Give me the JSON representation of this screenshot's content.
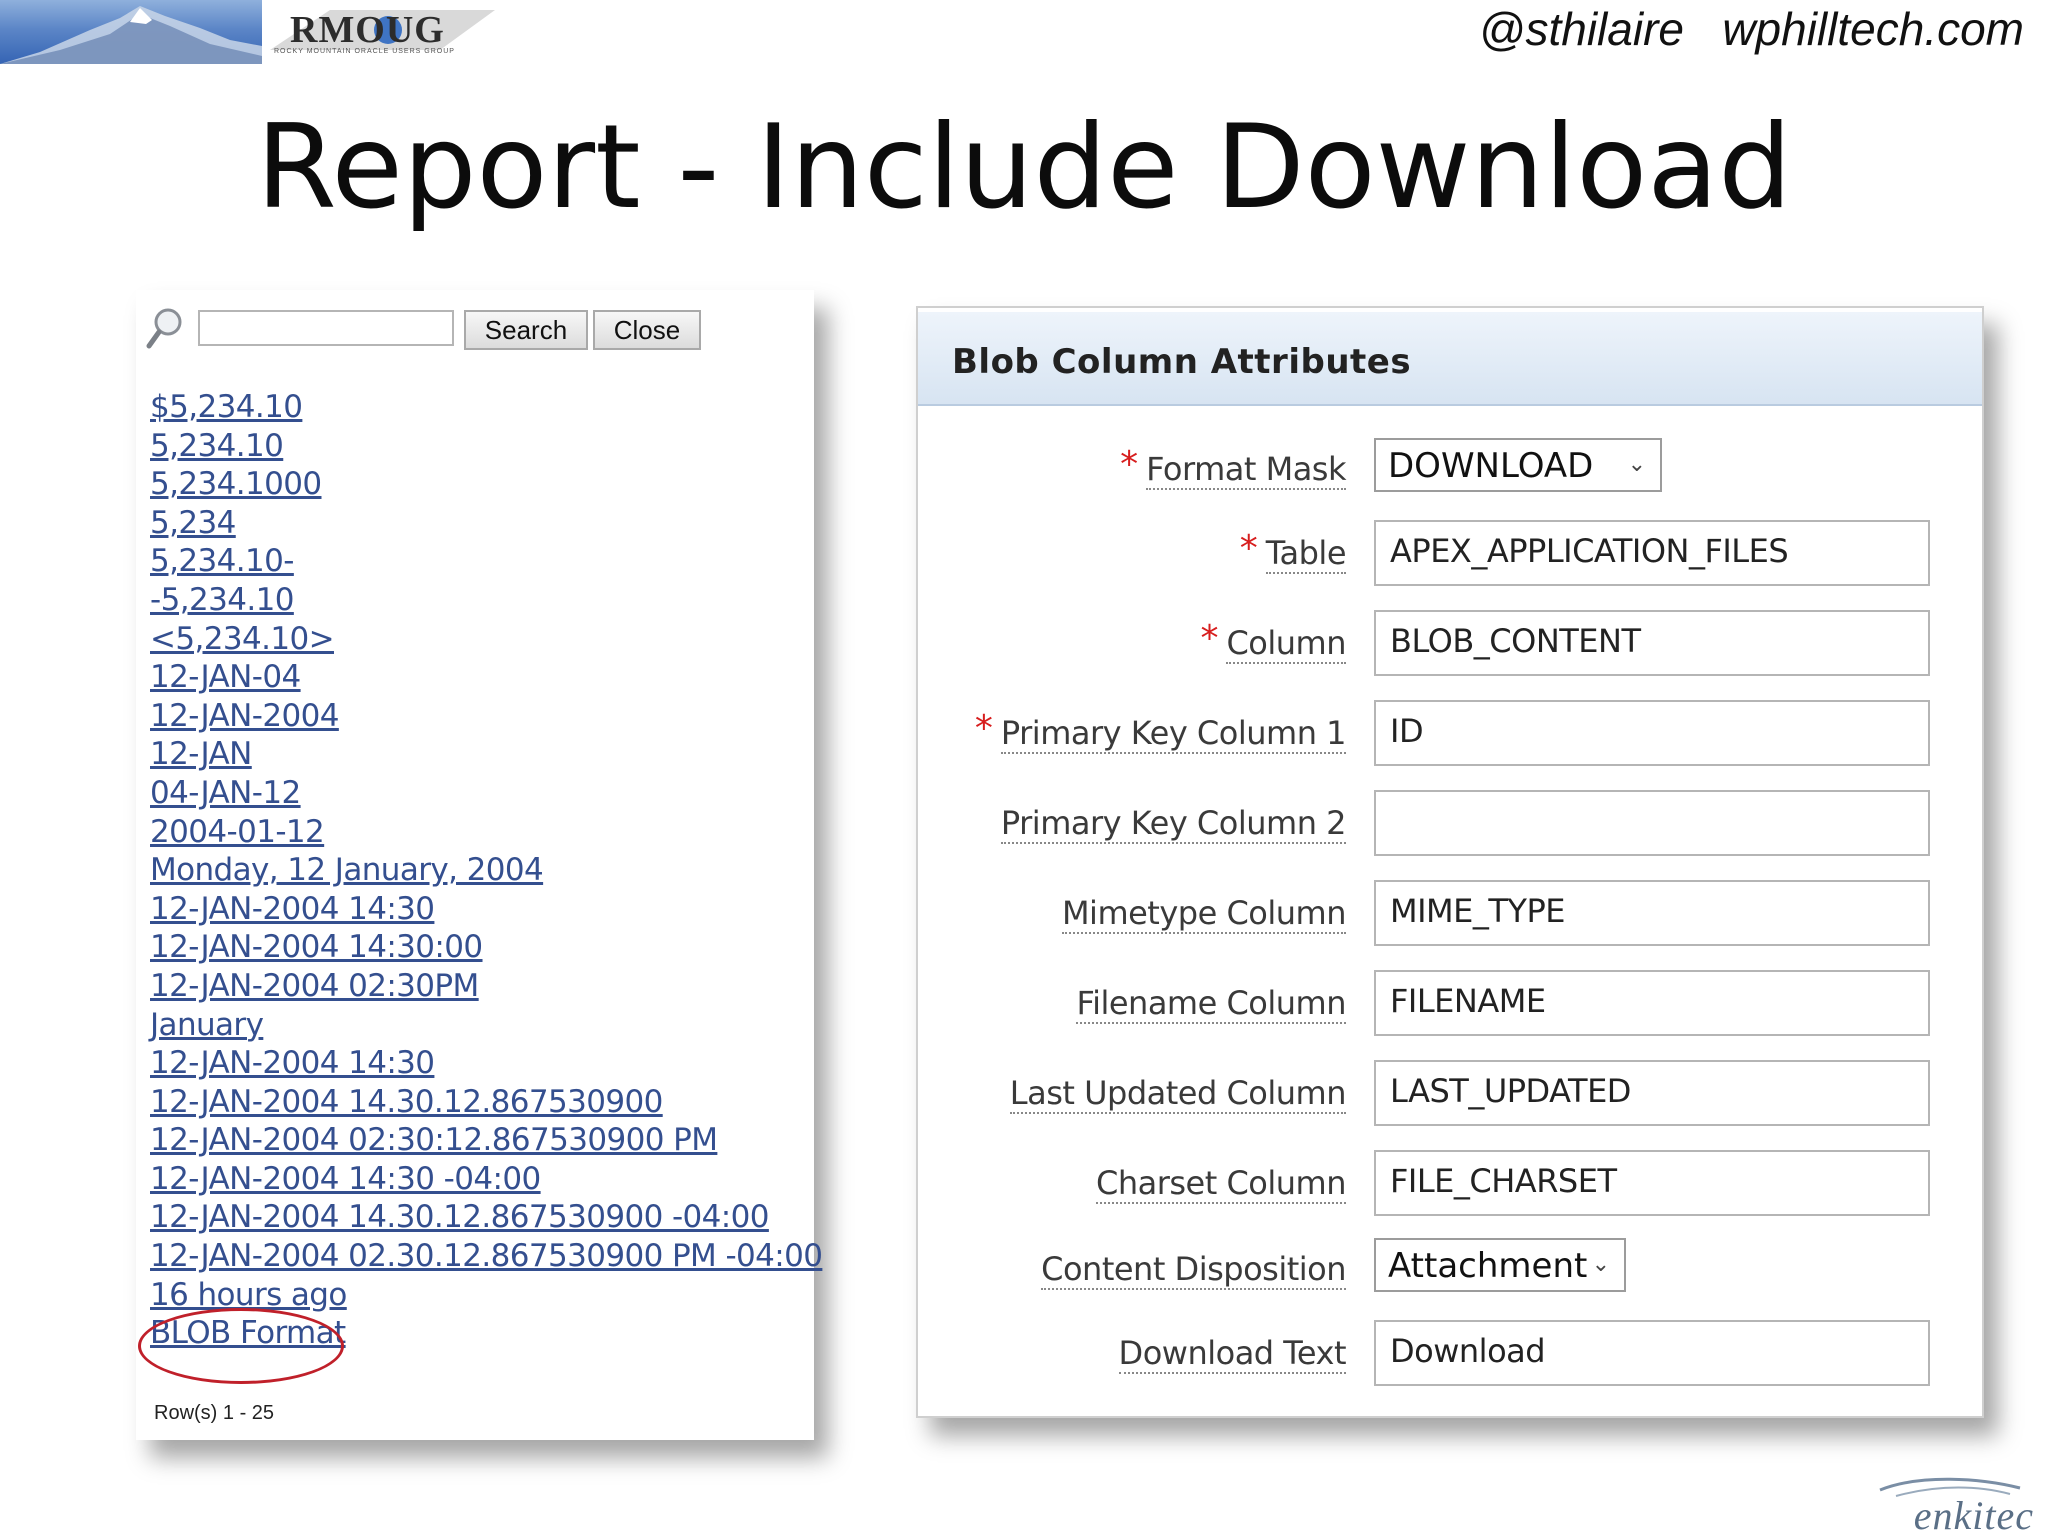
{
  "header": {
    "logo_text": "RMOUG",
    "logo_subtext": "ROCKY MOUNTAIN ORACLE USERS GROUP",
    "handle": "@sthilaire   wphilltech.com"
  },
  "slide_title": "Report - Include Download",
  "left_panel": {
    "search_button": "Search",
    "close_button": "Close",
    "search_value": "",
    "formats": [
      "$5,234.10",
      "5,234.10",
      "5,234.1000",
      "5,234",
      "5,234.10-",
      "-5,234.10",
      "<5,234.10>",
      "12-JAN-04",
      "12-JAN-2004",
      "12-JAN",
      "04-JAN-12",
      "2004-01-12",
      "Monday, 12 January, 2004",
      "12-JAN-2004 14:30",
      "12-JAN-2004 14:30:00",
      "12-JAN-2004 02:30PM",
      "January",
      "12-JAN-2004 14:30",
      "12-JAN-2004 14.30.12.867530900",
      "12-JAN-2004 02:30:12.867530900 PM",
      "12-JAN-2004 14:30 -04:00",
      "12-JAN-2004 14.30.12.867530900 -04:00",
      "12-JAN-2004 02.30.12.867530900 PM -04:00",
      "16 hours ago",
      "BLOB Format"
    ],
    "rows_text": "Row(s) 1 - 25"
  },
  "right_panel": {
    "title": "Blob Column Attributes",
    "fields": [
      {
        "label": "Format Mask",
        "value": "DOWNLOAD",
        "required": true,
        "kind": "select"
      },
      {
        "label": "Table",
        "value": "APEX_APPLICATION_FILES",
        "required": true,
        "kind": "input"
      },
      {
        "label": "Column",
        "value": "BLOB_CONTENT",
        "required": true,
        "kind": "input"
      },
      {
        "label": "Primary Key Column 1",
        "value": "ID",
        "required": true,
        "kind": "input"
      },
      {
        "label": "Primary Key Column 2",
        "value": "",
        "required": false,
        "kind": "input"
      },
      {
        "label": "Mimetype Column",
        "value": "MIME_TYPE",
        "required": false,
        "kind": "input"
      },
      {
        "label": "Filename Column",
        "value": "FILENAME",
        "required": false,
        "kind": "input"
      },
      {
        "label": "Last Updated Column",
        "value": "LAST_UPDATED",
        "required": false,
        "kind": "input"
      },
      {
        "label": "Charset Column",
        "value": "FILE_CHARSET",
        "required": false,
        "kind": "input"
      },
      {
        "label": "Content Disposition",
        "value": "Attachment",
        "required": false,
        "kind": "select"
      },
      {
        "label": "Download Text",
        "value": "Download",
        "required": false,
        "kind": "input"
      }
    ],
    "required_marker": "*",
    "chevron": "⌄"
  },
  "footer": {
    "brand": "enkitec"
  }
}
